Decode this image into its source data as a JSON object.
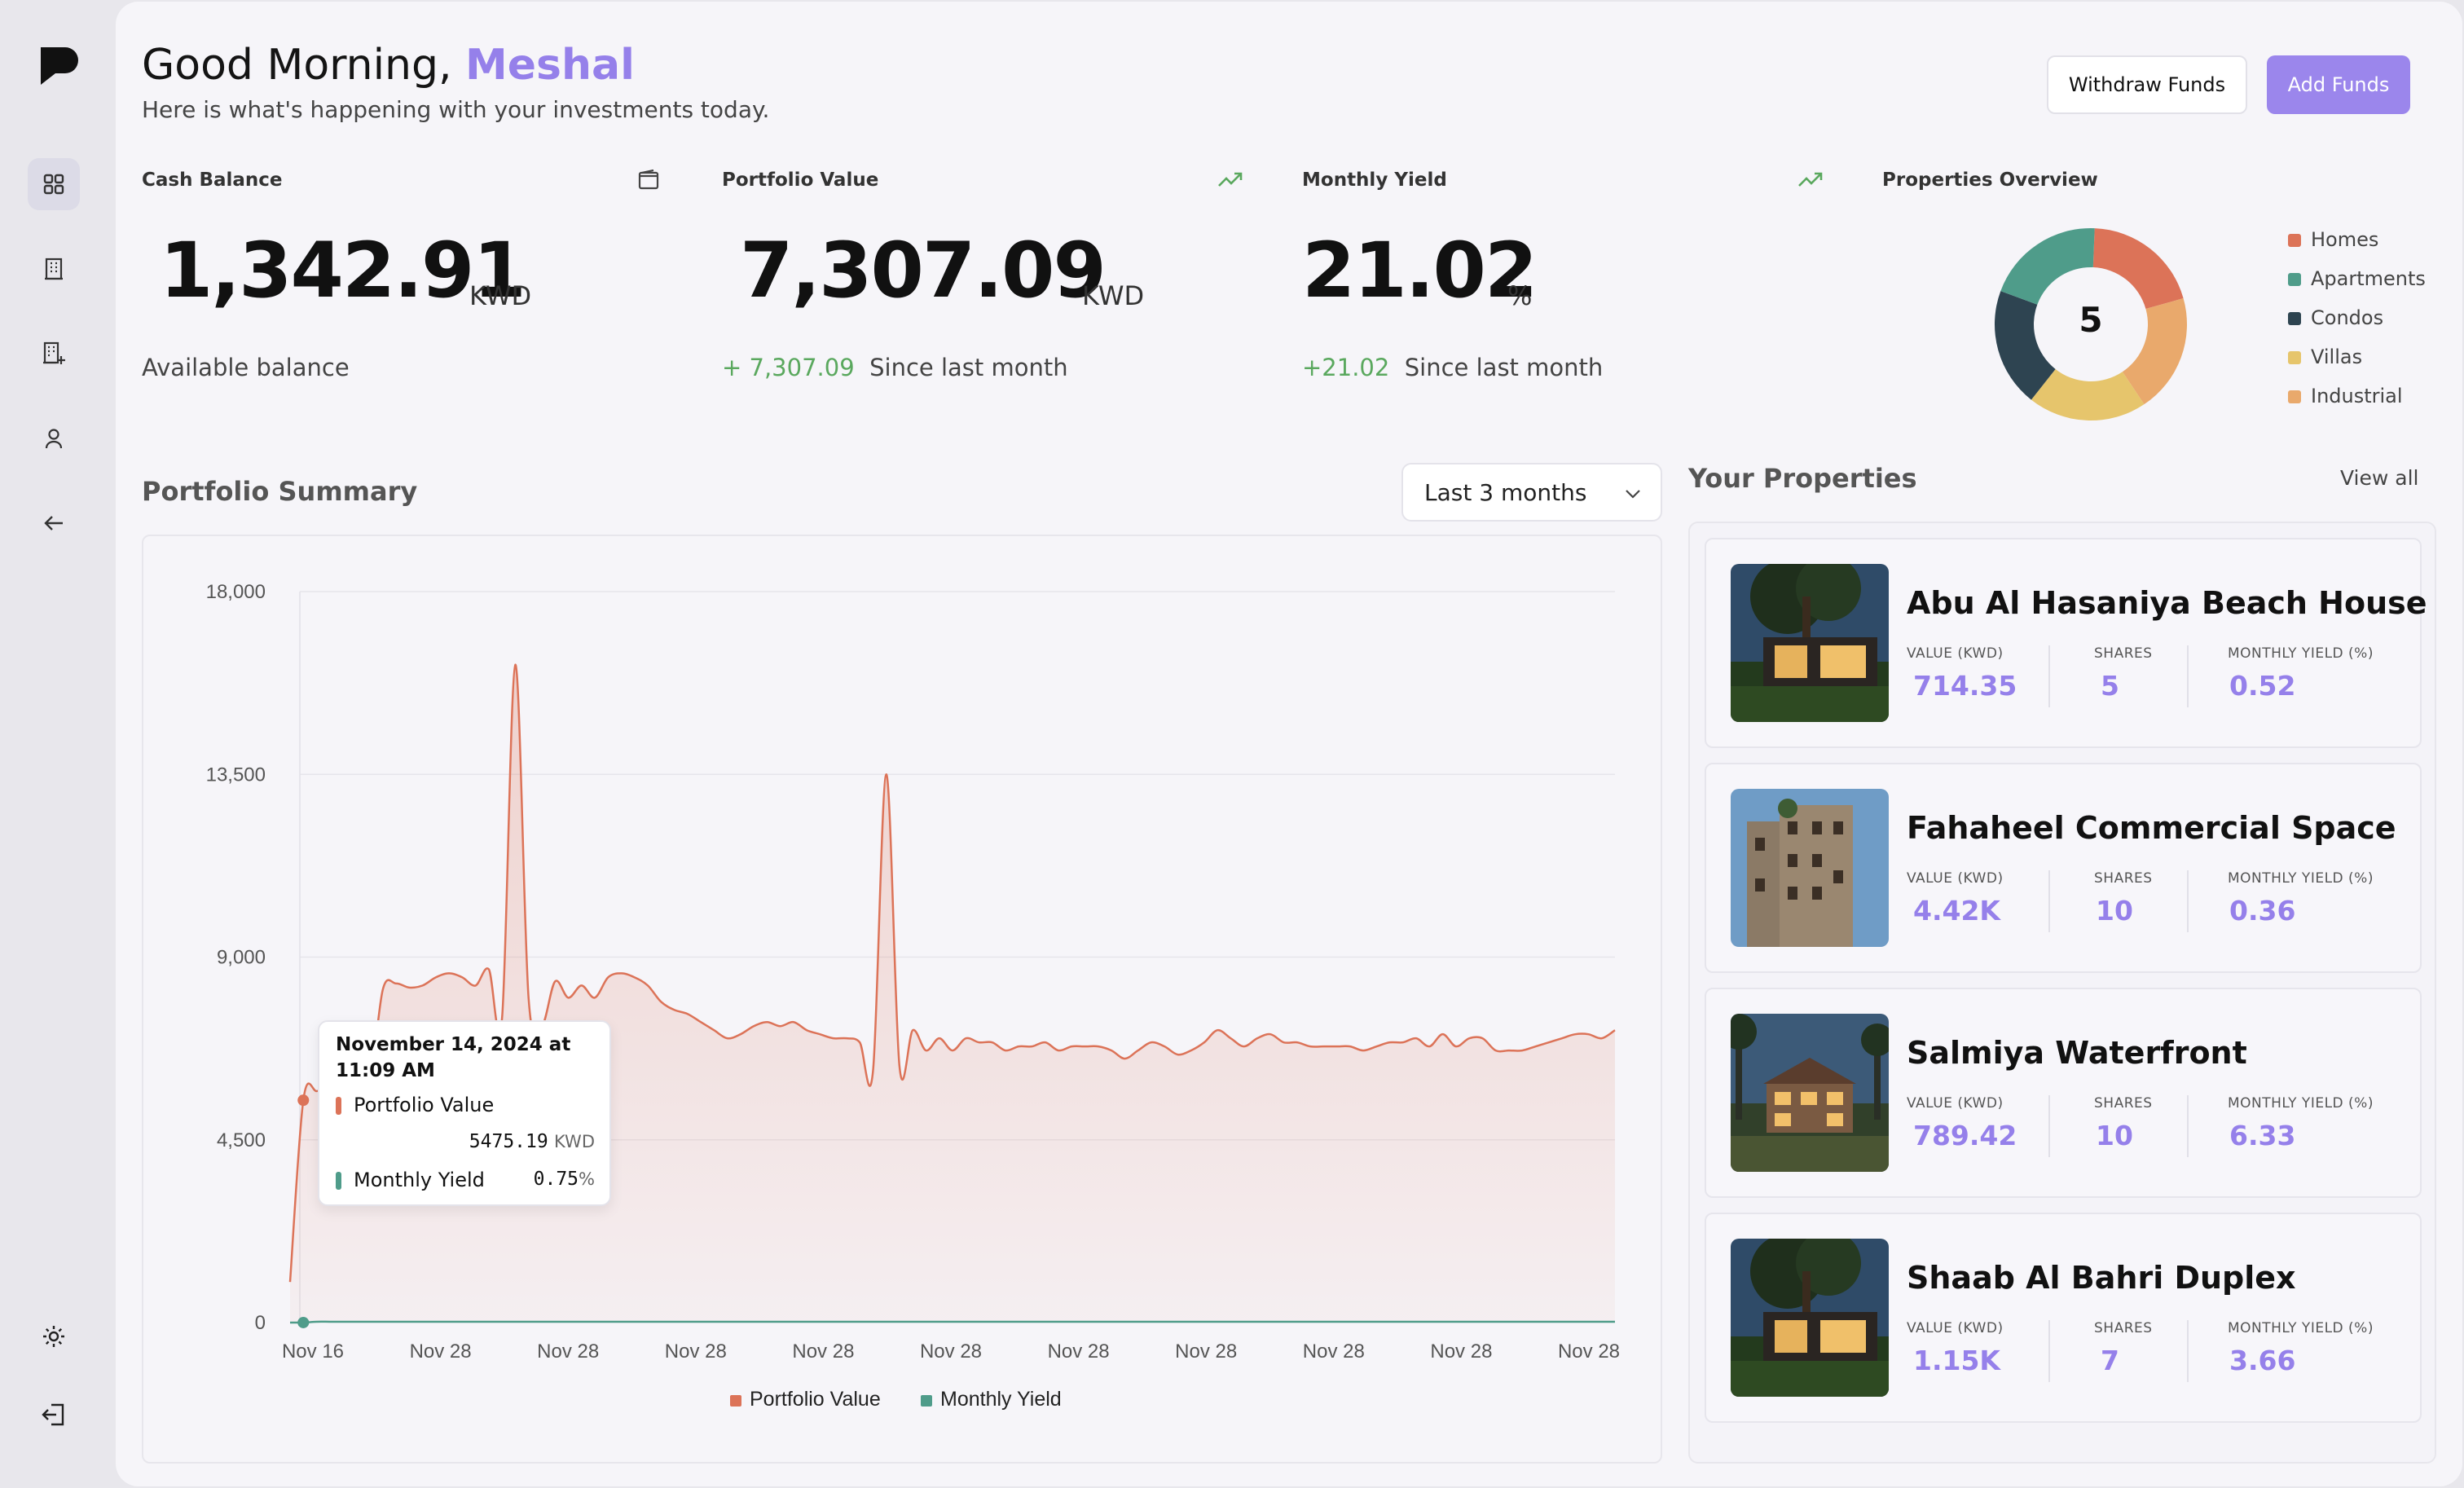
{
  "header": {
    "greeting": "Good Morning,",
    "user_name": "Meshal",
    "subtitle": "Here is what's happening with your investments today.",
    "withdraw_label": "Withdraw Funds",
    "add_label": "Add Funds"
  },
  "stats": {
    "cash": {
      "label": "Cash Balance",
      "value": "1,342.91",
      "unit": "KWD",
      "caption": "Available balance",
      "icon": "wallet-icon"
    },
    "portfolio": {
      "label": "Portfolio Value",
      "value": "7,307.09",
      "unit": "KWD",
      "change": "+ 7,307.09",
      "caption": "Since last month",
      "icon": "trending-up-icon"
    },
    "yield": {
      "label": "Monthly Yield",
      "value": "21.02",
      "unit": "%",
      "change": "+21.02",
      "caption": "Since last month",
      "icon": "trending-up-icon"
    },
    "overview": {
      "label": "Properties Overview",
      "total": "5",
      "legend": [
        "Homes",
        "Apartments",
        "Condos",
        "Villas",
        "Industrial"
      ]
    }
  },
  "summary": {
    "title": "Portfolio Summary",
    "range": "Last 3 months"
  },
  "tooltip": {
    "date": "November 14, 2024 at",
    "time": "11:09 AM",
    "pv_label": "Portfolio Value",
    "pv_value": "5475.19",
    "pv_unit": "KWD",
    "my_label": "Monthly Yield",
    "my_value": "0.75",
    "my_unit": "%"
  },
  "properties": {
    "title": "Your Properties",
    "view_all": "View all",
    "label_value": "VALUE (KWD)",
    "label_shares": "SHARES",
    "label_yield": "MONTHLY YIELD (%)",
    "items": [
      {
        "name": "Abu Al Hasaniya Beach House",
        "value": "714.35",
        "shares": "5",
        "yield": "0.52"
      },
      {
        "name": "Fahaheel Commercial Space",
        "value": "4.42K",
        "shares": "10",
        "yield": "0.36"
      },
      {
        "name": "Salmiya Waterfront",
        "value": "789.42",
        "shares": "10",
        "yield": "6.33"
      },
      {
        "name": "Shaab Al Bahri Duplex",
        "value": "1.15K",
        "shares": "7",
        "yield": "3.66"
      }
    ]
  },
  "colors": {
    "accent": "#9580ea",
    "homes": "#dc7358",
    "apartments": "#4f9c8a",
    "condos": "#2e4451",
    "villas": "#e6c56c",
    "industrial": "#e9a96c",
    "positive": "#5aa85e"
  },
  "chart_data": [
    {
      "type": "area",
      "title": "",
      "x_ticks": [
        "Nov 16",
        "Nov 28",
        "Nov 28",
        "Nov 28",
        "Nov 28",
        "Nov 28",
        "Nov 28",
        "Nov 28",
        "Nov 28",
        "Nov 28",
        "Nov 28"
      ],
      "y_ticks": [
        "18,000",
        "13,500",
        "9,000",
        "4,500",
        "0"
      ],
      "ylim": [
        0,
        18000
      ],
      "grid": true,
      "legend": "bottom",
      "series": [
        {
          "name": "Portfolio Value",
          "color": "#dc7358",
          "values": [
            1000,
            5475,
            5700,
            5600,
            5500,
            5600,
            5800,
            8200,
            8350,
            8250,
            8300,
            8500,
            8600,
            8500,
            8300,
            8700,
            7500,
            16200,
            8000,
            7300,
            8400,
            8000,
            8300,
            8000,
            8500,
            8600,
            8500,
            8300,
            7900,
            7700,
            7600,
            7400,
            7200,
            7000,
            7100,
            7300,
            7400,
            7300,
            7400,
            7200,
            7100,
            7000,
            7000,
            6900,
            6200,
            13500,
            6300,
            7200,
            6700,
            7000,
            6700,
            7000,
            6900,
            6900,
            6700,
            6800,
            6800,
            6900,
            6700,
            6800,
            6800,
            6800,
            6700,
            6500,
            6700,
            6900,
            6800,
            6600,
            6700,
            6900,
            7200,
            7000,
            6800,
            7000,
            7100,
            6900,
            6900,
            6800,
            6800,
            6800,
            6800,
            6700,
            6800,
            6900,
            6900,
            7000,
            6800,
            7100,
            6800,
            7000,
            7000,
            6700,
            6700,
            6700,
            6800,
            6900,
            7000,
            7100,
            7100,
            7000,
            7200
          ]
        },
        {
          "name": "Monthly Yield",
          "color": "#4f9c8a",
          "values": [
            0,
            0.75,
            21,
            21,
            21,
            21,
            21,
            21,
            21,
            21,
            21,
            21,
            21,
            21,
            21,
            21,
            21,
            21,
            21,
            21,
            21,
            21,
            21,
            21,
            21,
            21,
            21,
            21,
            21,
            21,
            21,
            21,
            21,
            21,
            21,
            21,
            21,
            21,
            21,
            21,
            21,
            21,
            21,
            21,
            21,
            21,
            21,
            21,
            21,
            21,
            21,
            21,
            21,
            21,
            21,
            21,
            21,
            21,
            21,
            21,
            21,
            21,
            21,
            21,
            21,
            21,
            21,
            21,
            21,
            21,
            21,
            21,
            21,
            21,
            21,
            21,
            21,
            21,
            21,
            21,
            21,
            21,
            21,
            21,
            21,
            21,
            21,
            21,
            21,
            21,
            21,
            21,
            21,
            21,
            21,
            21,
            21,
            21,
            21,
            21,
            21
          ]
        }
      ]
    },
    {
      "type": "pie",
      "title": "",
      "center_label": "5",
      "slices": [
        {
          "label": "Homes",
          "value": 1,
          "color": "#dc7358"
        },
        {
          "label": "Industrial",
          "value": 1,
          "color": "#e9a96c"
        },
        {
          "label": "Villas",
          "value": 1,
          "color": "#e6c56c"
        },
        {
          "label": "Condos",
          "value": 1,
          "color": "#2e4451"
        },
        {
          "label": "Apartments",
          "value": 1,
          "color": "#4f9c8a"
        }
      ]
    }
  ]
}
